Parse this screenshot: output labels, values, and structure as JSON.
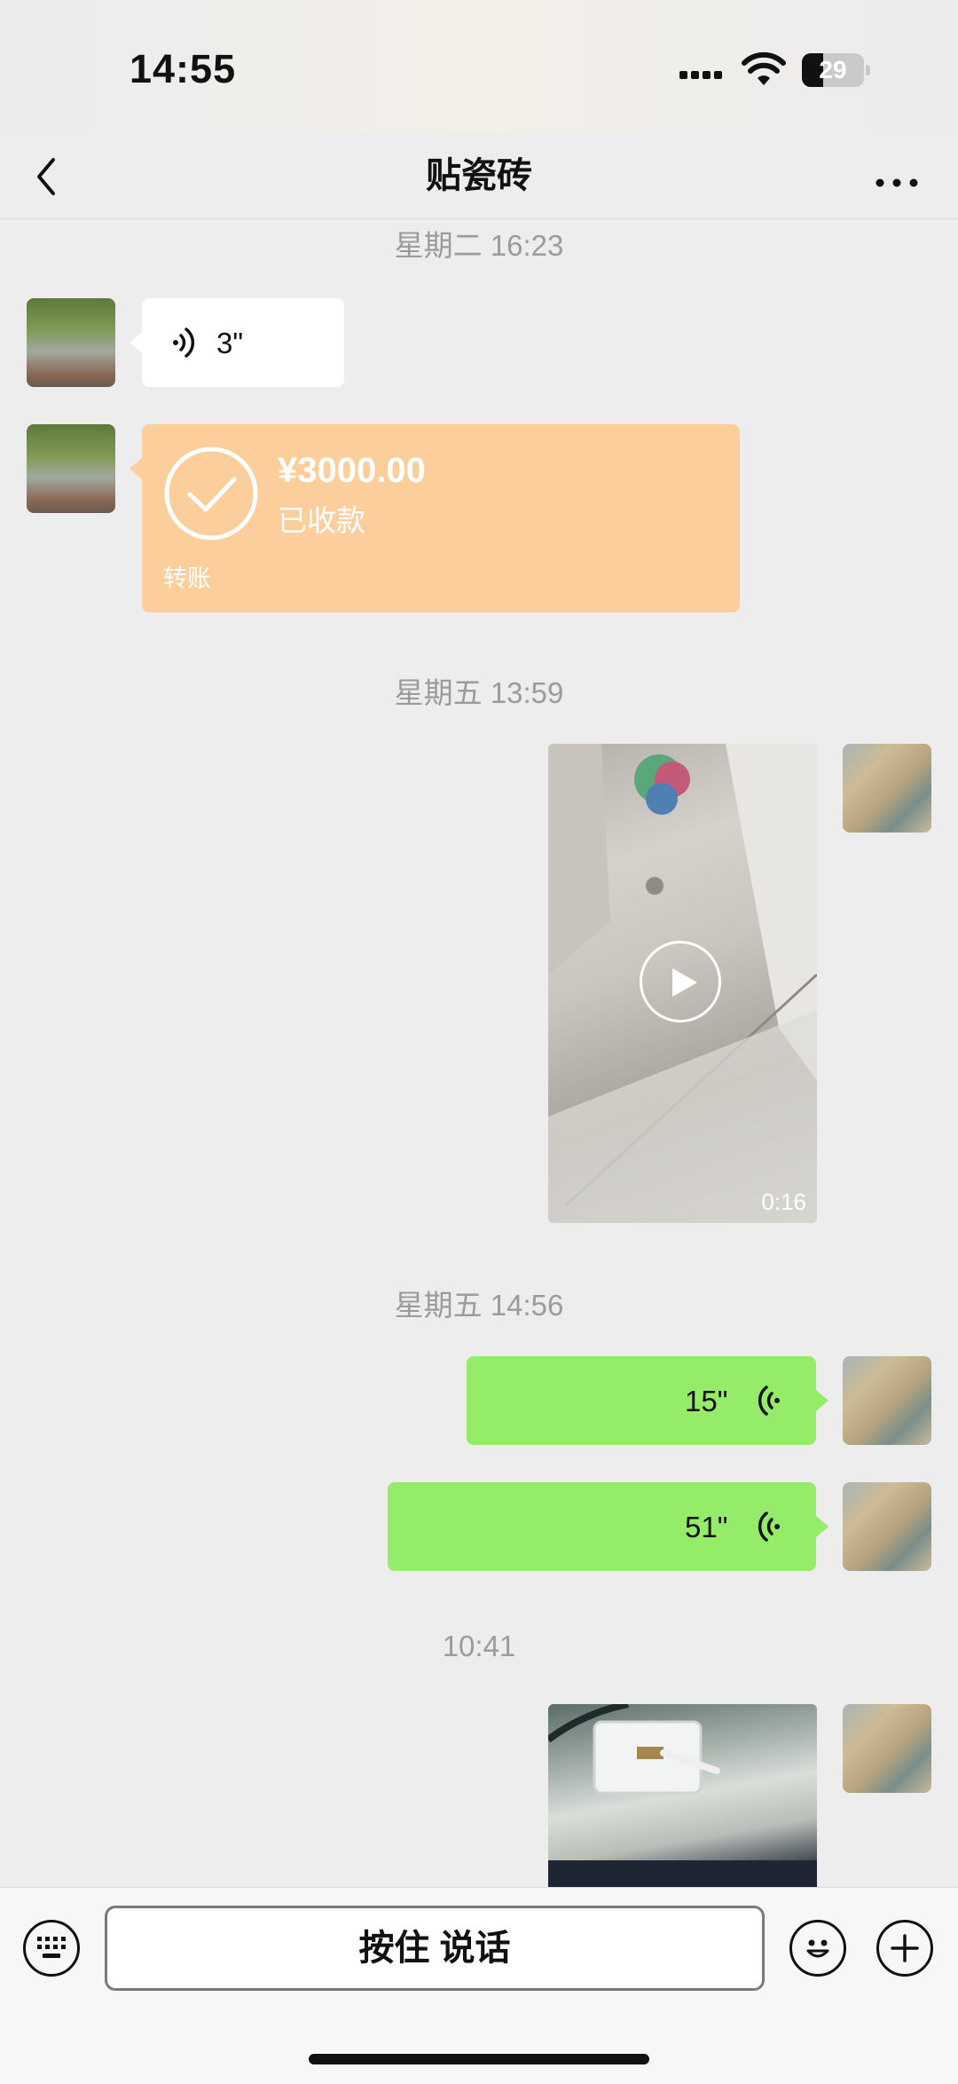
{
  "status_bar": {
    "time": "14:55",
    "battery": "29"
  },
  "header": {
    "title": "贴瓷砖",
    "back_icon": "chevron-left-icon",
    "more_icon": "ellipsis-icon"
  },
  "messages": {
    "ts1": "星期二 16:23",
    "voice_in_1": "3\"",
    "transfer": {
      "amount": "¥3000.00",
      "status": "已收款",
      "label": "转账"
    },
    "ts2": "星期五 13:59",
    "video_duration": "0:16",
    "ts3": "星期五 14:56",
    "voice_out_1": "15\"",
    "voice_out_2": "51\"",
    "ts4": "10:41"
  },
  "input_bar": {
    "hold_to_talk": "按住 说话"
  },
  "colors": {
    "sent_bubble": "#95EC69",
    "transfer_card": "#FCCE9C",
    "background": "#EDEDED"
  }
}
